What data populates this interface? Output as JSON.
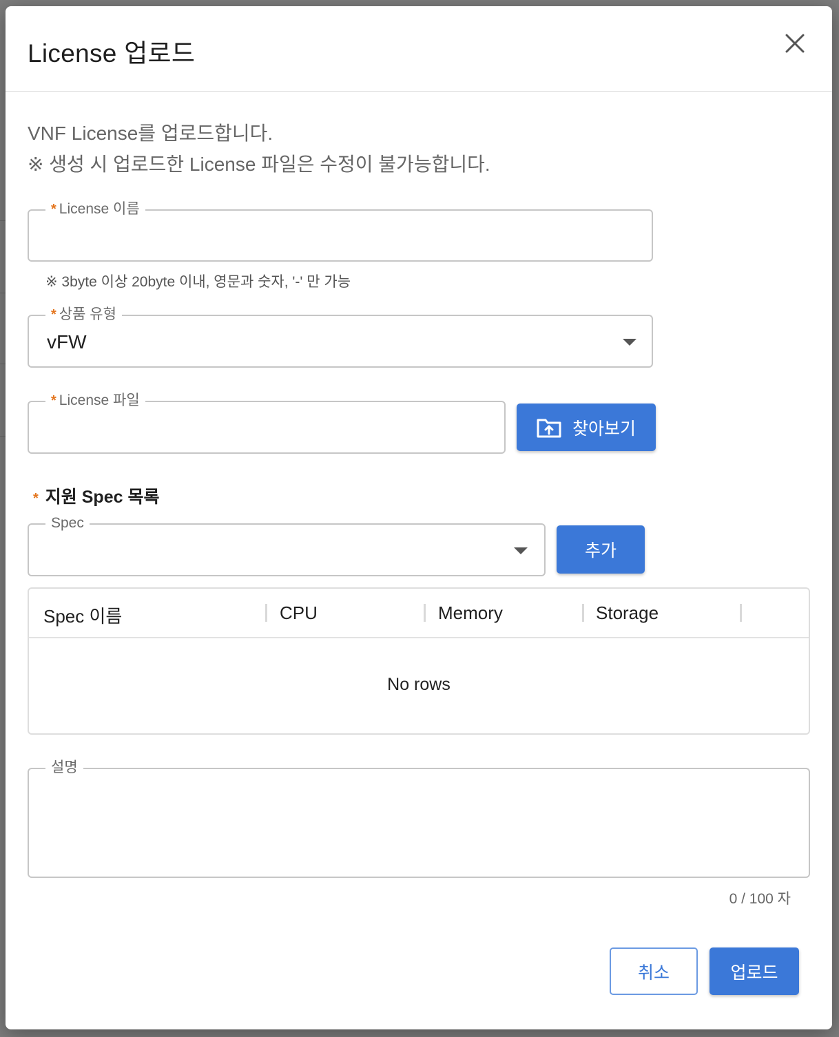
{
  "dialog": {
    "title": "License 업로드",
    "description_line1": "VNF License를 업로드합니다.",
    "description_line2": "※ 생성 시 업로드한 License 파일은 수정이 불가능합니다."
  },
  "fields": {
    "required_mark": "*",
    "license_name": {
      "label": "License 이름",
      "value": "",
      "hint": "※ 3byte 이상 20byte 이내, 영문과 숫자, '-' 만 가능"
    },
    "product_type": {
      "label": "상품 유형",
      "value": "vFW"
    },
    "license_file": {
      "label": "License 파일",
      "value": "",
      "browse_label": "찾아보기"
    },
    "spec_section": {
      "title": "지원 Spec 목록",
      "spec_label": "Spec",
      "spec_value": "",
      "add_label": "추가"
    },
    "description": {
      "label": "설명",
      "value": "",
      "counter": "0 / 100 자"
    }
  },
  "spec_table": {
    "columns": [
      "Spec 이름",
      "CPU",
      "Memory",
      "Storage"
    ],
    "rows": [],
    "empty_text": "No rows"
  },
  "footer": {
    "cancel_label": "취소",
    "upload_label": "업로드"
  },
  "colors": {
    "primary": "#3b78d8",
    "required": "#e4761f"
  }
}
